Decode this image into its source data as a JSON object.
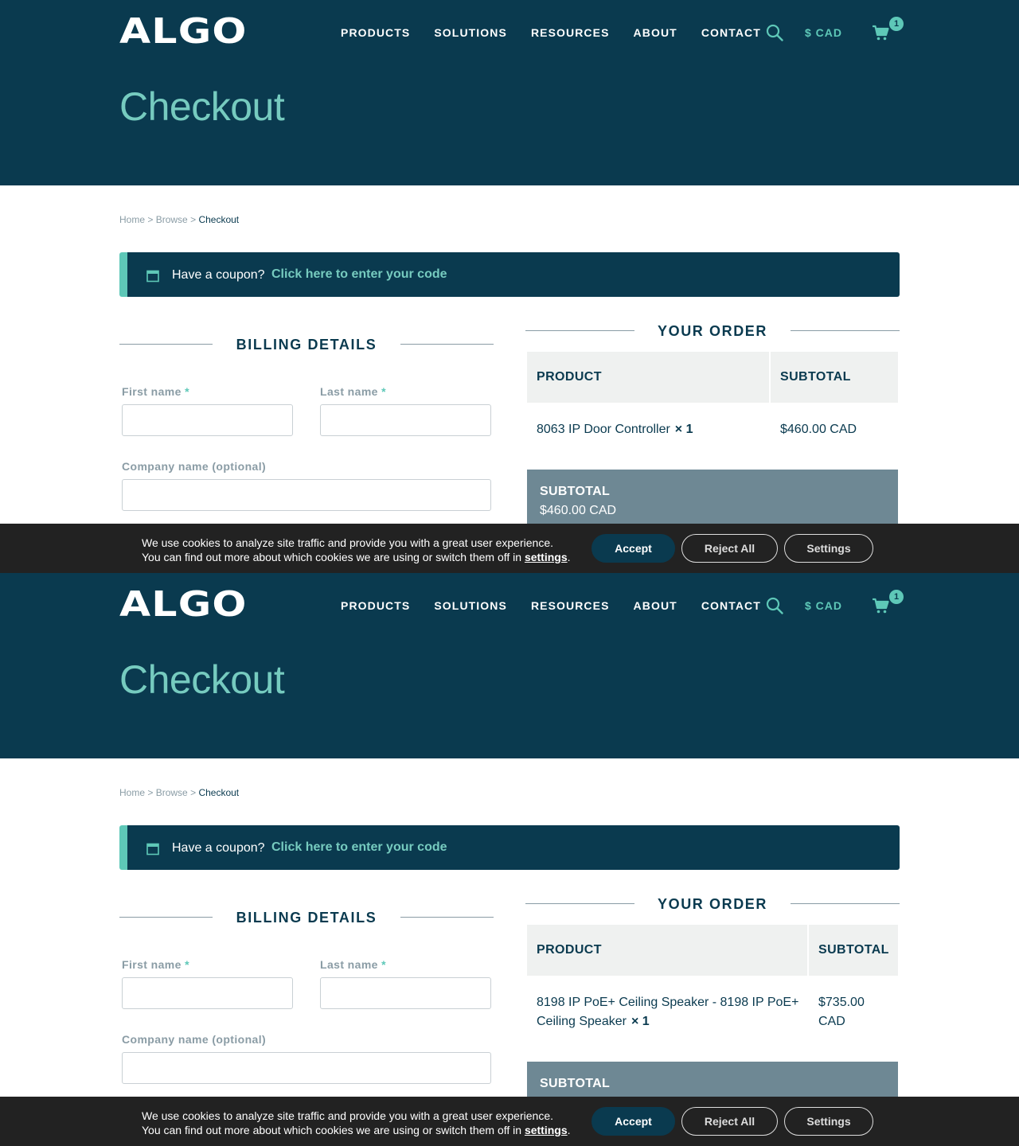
{
  "brand": {
    "logo_text": "ALGO"
  },
  "nav": {
    "items": [
      "PRODUCTS",
      "SOLUTIONS",
      "RESOURCES",
      "ABOUT",
      "CONTACT"
    ],
    "currency": "$ CAD",
    "cart_count": "1"
  },
  "page": {
    "title": "Checkout"
  },
  "breadcrumb": {
    "home": "Home",
    "sep": ">",
    "browse": "Browse",
    "current": "Checkout"
  },
  "coupon": {
    "question": "Have a coupon?",
    "link": "Click here to enter your code"
  },
  "billing": {
    "heading": "BILLING DETAILS",
    "first_name_label": "First name",
    "last_name_label": "Last name",
    "required_mark": "*",
    "company_label": "Company name (optional)"
  },
  "order": {
    "heading": "YOUR ORDER",
    "col_product": "PRODUCT",
    "col_subtotal": "SUBTOTAL",
    "subtotal_label": "SUBTOTAL"
  },
  "views": [
    {
      "item_name": "8063 IP Door Controller",
      "item_qty": "× 1",
      "item_subtotal": "$460.00 CAD",
      "subtotal_value": "$460.00 CAD"
    },
    {
      "item_name": "8198 IP PoE+ Ceiling Speaker - 8198 IP PoE+ Ceiling Speaker",
      "item_qty": "× 1",
      "item_subtotal": "$735.00 CAD",
      "subtotal_value": ""
    }
  ],
  "cookie": {
    "line1": "We use cookies to analyze site traffic and provide you with a great user experience.",
    "line2": "You can find out more about which cookies we are using or switch them off in",
    "settings_link": "settings",
    "period": ".",
    "accept": "Accept",
    "reject": "Reject All",
    "settings_button": "Settings"
  },
  "colors": {
    "navy": "#0a3a4f",
    "teal": "#5ec8b8",
    "slate": "#6e8894",
    "cookie_bg": "#222222"
  }
}
